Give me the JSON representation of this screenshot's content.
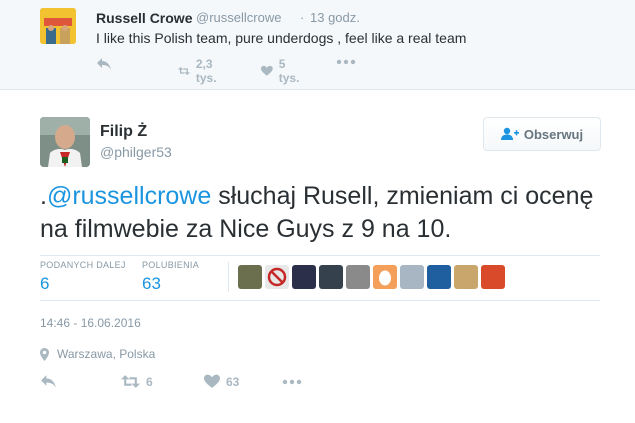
{
  "parent_tweet": {
    "name": "Russell Crowe",
    "handle": "@russellcrowe",
    "separator": "·",
    "time": "13 godz.",
    "text": "I like this Polish team, pure underdogs , feel like a real team",
    "retweet_count": "2,3 tys.",
    "like_count": "5 tys.",
    "icons": [
      "reply-icon",
      "retweet-icon",
      "heart-icon",
      "more-icon"
    ]
  },
  "main_tweet": {
    "name": "Filip Ż",
    "handle": "@philger53",
    "follow_label": "Obserwuj",
    "text_prefix": ".",
    "mention": "@russellcrowe",
    "text_body": " słuchaj Rusell, zmieniam ci ocenę na filmwebie za Nice Guys z 9 na 10.",
    "stats": {
      "retweets_label": "PODANYCH DALEJ",
      "retweets_value": "6",
      "likes_label": "POLUBIENIA",
      "likes_value": "63"
    },
    "timestamp": "14:46 - 16.06.2016",
    "location": "Warszawa, Polska",
    "actions": {
      "retweet_count": "6",
      "like_count": "63"
    }
  },
  "colors": {
    "link": "#1b95e0",
    "muted": "#8899a6",
    "text": "#292f33",
    "divider": "#e1e8ed"
  }
}
